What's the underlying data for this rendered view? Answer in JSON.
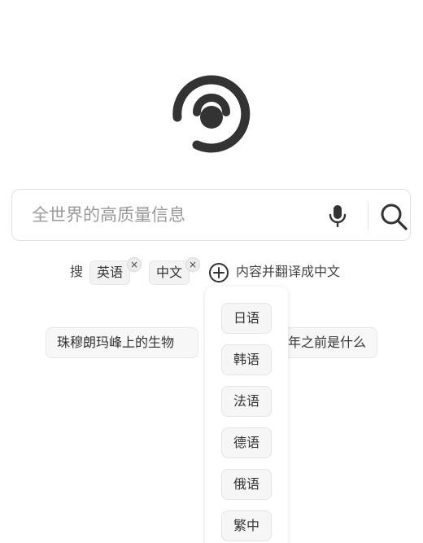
{
  "logo": {
    "icon": "radio-signal-logo-icon",
    "color": "#333333"
  },
  "search": {
    "placeholder": "全世界的高质量信息",
    "value": ""
  },
  "instruction": {
    "prefix": "搜",
    "selected_languages": [
      {
        "label": "英语"
      },
      {
        "label": "中文"
      }
    ],
    "remove_symbol": "×",
    "suffix": "内容并翻译成中文"
  },
  "suggestions": [
    {
      "label": "珠穆朗玛峰上的生物"
    },
    {
      "label": "年之前是什么"
    }
  ],
  "language_dropdown": {
    "options": [
      {
        "label": "日语"
      },
      {
        "label": "韩语"
      },
      {
        "label": "法语"
      },
      {
        "label": "德语"
      },
      {
        "label": "俄语"
      },
      {
        "label": "繁中"
      }
    ]
  }
}
